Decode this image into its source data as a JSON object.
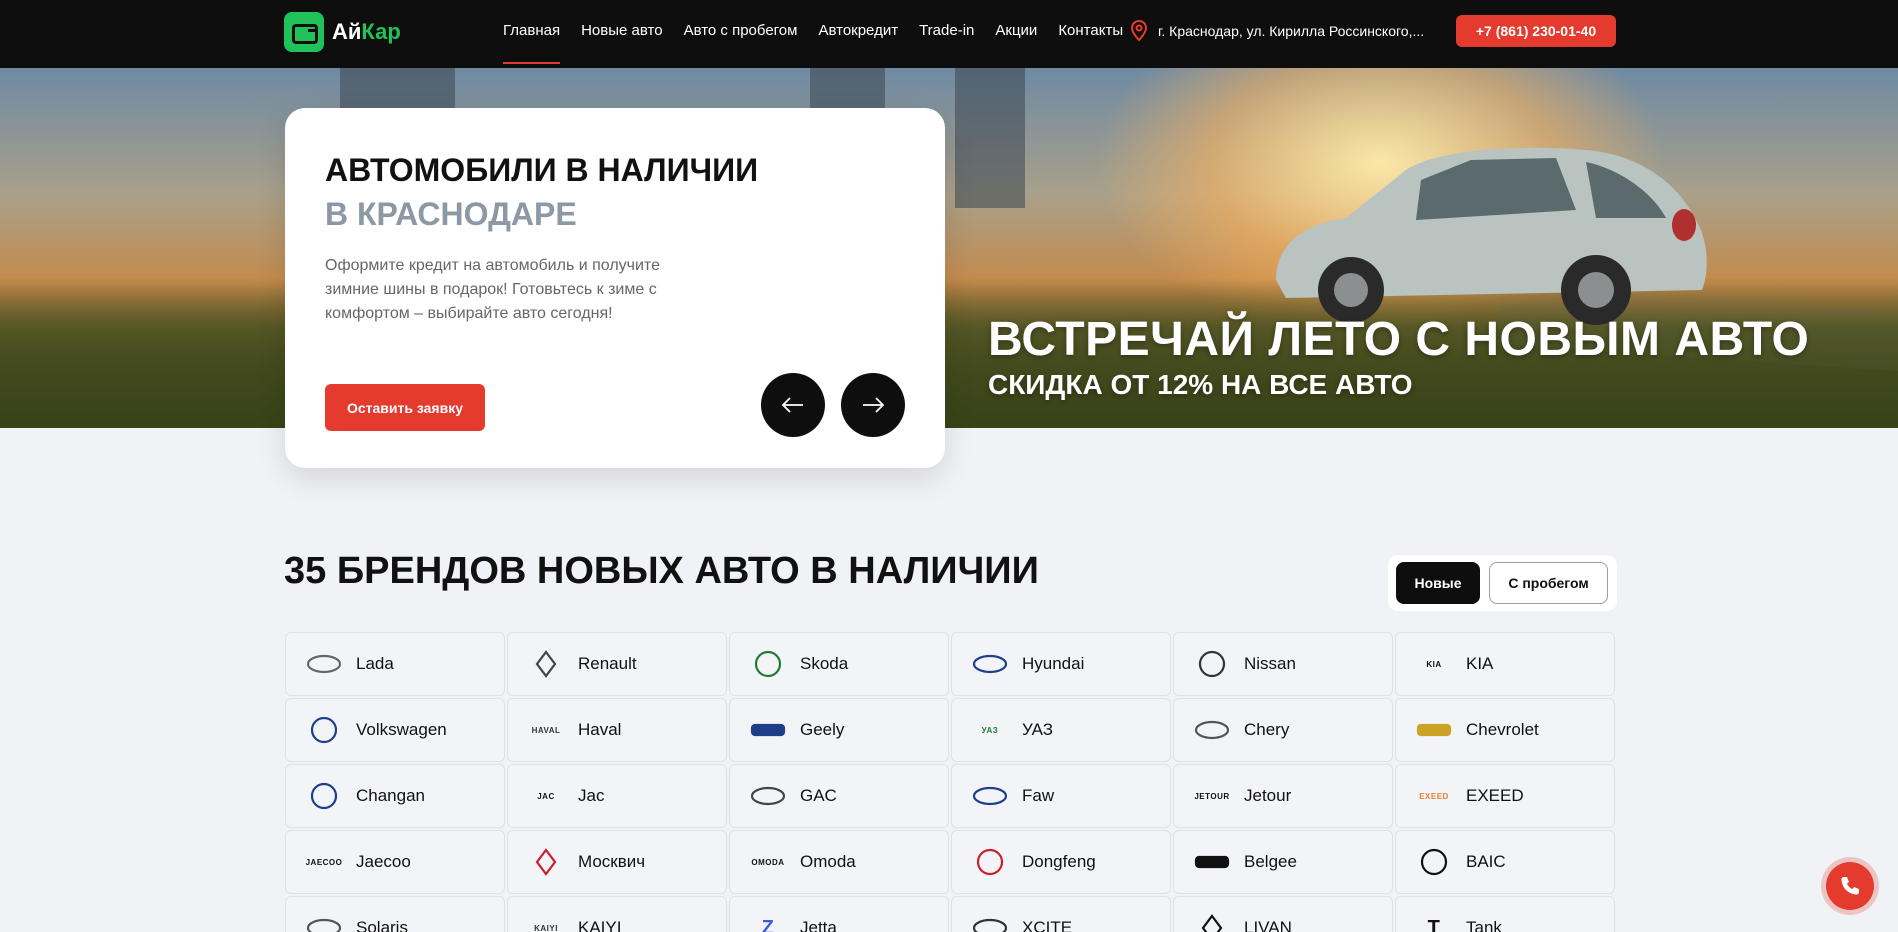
{
  "header": {
    "logo": {
      "text_main": "Ай",
      "text_accent": "Кар"
    },
    "nav": [
      "Главная",
      "Новые авто",
      "Авто с пробегом",
      "Автокредит",
      "Trade-in",
      "Акции",
      "Контакты"
    ],
    "active_nav": "Главная",
    "address": "г. Краснодар, ул. Кирилла Россинского,...",
    "phone": "+7 (861) 230-01-40",
    "icons": {
      "address": "map-pin-icon"
    }
  },
  "hero": {
    "title_line1": "АВТОМОБИЛИ В НАЛИЧИИ",
    "title_line2": "В КРАСНОДАРЕ",
    "description": "Оформите кредит на автомобиль и получите зимние шины в подарок! Готовьтесь к зиме с комфортом – выбирайте авто сегодня!",
    "cta": "Оставить заявку",
    "promo_title": "ВСТРЕЧАЙ ЛЕТО С НОВЫМ АВТО",
    "promo_subtitle": "СКИДКА ОТ 12% НА ВСЕ АВТО",
    "icons": {
      "prev": "arrow-left-icon",
      "next": "arrow-right-icon"
    }
  },
  "brands": {
    "title": "35 БРЕНДОВ НОВЫХ АВТО В НАЛИЧИИ",
    "toggle": {
      "new": "Новые",
      "used": "С пробегом",
      "selected": "Новые"
    },
    "items": [
      {
        "name": "Lada",
        "logo": "ellipse-logo",
        "color": "#666666"
      },
      {
        "name": "Renault",
        "logo": "diamond-logo",
        "color": "#444444"
      },
      {
        "name": "Skoda",
        "logo": "circle-logo",
        "color": "#1f7a3a"
      },
      {
        "name": "Hyundai",
        "logo": "ellipse-logo",
        "color": "#1d3f8a"
      },
      {
        "name": "Nissan",
        "logo": "circle-logo",
        "color": "#333333"
      },
      {
        "name": "KIA",
        "logo": "text-logo",
        "mark": "KIA",
        "color": "#111111"
      },
      {
        "name": "Volkswagen",
        "logo": "circle-logo",
        "color": "#1d3f8a"
      },
      {
        "name": "Haval",
        "logo": "text-logo",
        "mark": "HAVAL",
        "color": "#333333"
      },
      {
        "name": "Geely",
        "logo": "bar-logo",
        "color": "#1d3f8a"
      },
      {
        "name": "УАЗ",
        "logo": "text-logo",
        "mark": "УАЗ",
        "color": "#1f7a3a"
      },
      {
        "name": "Chery",
        "logo": "ellipse-logo",
        "color": "#555555"
      },
      {
        "name": "Chevrolet",
        "logo": "bar-logo",
        "color": "#c9a227"
      },
      {
        "name": "Changan",
        "logo": "circle-logo",
        "color": "#1d3f8a"
      },
      {
        "name": "Jac",
        "logo": "text-logo",
        "mark": "JAC",
        "color": "#111111"
      },
      {
        "name": "GAC",
        "logo": "ellipse-logo",
        "color": "#444444"
      },
      {
        "name": "Faw",
        "logo": "ellipse-logo",
        "color": "#1d3f8a"
      },
      {
        "name": "Jetour",
        "logo": "text-logo",
        "mark": "JETOUR",
        "color": "#111111"
      },
      {
        "name": "EXEED",
        "logo": "text-logo",
        "mark": "EXEED",
        "color": "#e0803a"
      },
      {
        "name": "Jaecoo",
        "logo": "text-logo",
        "mark": "JAECOO",
        "color": "#111111"
      },
      {
        "name": "Москвич",
        "logo": "diamond-logo",
        "color": "#c8202c"
      },
      {
        "name": "Omoda",
        "logo": "text-logo",
        "mark": "OMODA",
        "color": "#111111"
      },
      {
        "name": "Dongfeng",
        "logo": "circle-logo",
        "color": "#c8202c"
      },
      {
        "name": "Belgee",
        "logo": "bar-logo",
        "color": "#111111"
      },
      {
        "name": "BAIC",
        "logo": "circle-logo",
        "color": "#111111"
      },
      {
        "name": "Solaris",
        "logo": "ellipse-logo",
        "color": "#555555"
      },
      {
        "name": "KAIYI",
        "logo": "text-logo",
        "mark": "KAIYI",
        "color": "#333333"
      },
      {
        "name": "Jetta",
        "logo": "text-logo",
        "mark": "Z",
        "color": "#3f5bd8"
      },
      {
        "name": "XCITE",
        "logo": "ellipse-logo",
        "color": "#333333"
      },
      {
        "name": "LIVAN",
        "logo": "diamond-logo",
        "color": "#111111"
      },
      {
        "name": "Tank",
        "logo": "text-logo",
        "mark": "T",
        "color": "#111111"
      }
    ]
  },
  "floating": {
    "call_icon": "phone-icon"
  },
  "colors": {
    "accent": "#e53a2e",
    "brand_green": "#21c25a",
    "header_bg": "#0e0e0e",
    "page_bg": "#f1f2f6"
  }
}
